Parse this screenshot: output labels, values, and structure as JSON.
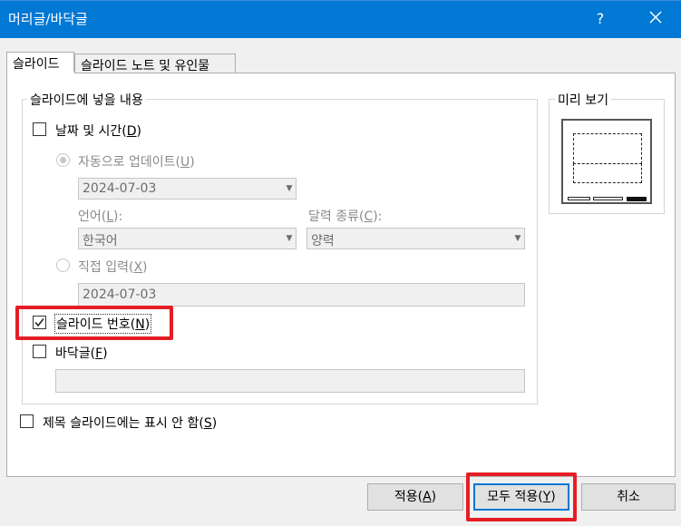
{
  "window": {
    "title": "머리글/바닥글",
    "help_label": "?"
  },
  "tabs": [
    {
      "label": "슬라이드"
    },
    {
      "label": "슬라이드 노트 및 유인물"
    }
  ],
  "include": {
    "legend": "슬라이드에 넣을 내용",
    "date_time": {
      "label": "날짜 및 시간(",
      "key": "D",
      "suffix": ")",
      "checked": false
    },
    "auto_update": {
      "label": "자동으로 업데이트(",
      "key": "U",
      "suffix": ")",
      "selected": true,
      "date_value": "2024-07-03"
    },
    "language": {
      "label": "언어(",
      "key": "L",
      "suffix": "):",
      "value": "한국어"
    },
    "calendar": {
      "label": "달력 종류(",
      "key": "C",
      "suffix": "):",
      "value": "양력"
    },
    "fixed": {
      "label": "직접 입력(",
      "key": "X",
      "suffix": ")",
      "selected": false,
      "value": "2024-07-03"
    },
    "slide_number": {
      "label": "슬라이드 번호(",
      "key": "N",
      "suffix": ")",
      "checked": true
    },
    "footer": {
      "label": "바닥글(",
      "key": "F",
      "suffix": ")",
      "checked": false,
      "value": ""
    }
  },
  "dont_show_title": {
    "label": "제목 슬라이드에는 표시 안 함(",
    "key": "S",
    "suffix": ")",
    "checked": false
  },
  "preview": {
    "legend": "미리 보기"
  },
  "buttons": {
    "apply": {
      "label": "적용(",
      "key": "A",
      "suffix": ")"
    },
    "apply_all": {
      "label": "모두 적용(",
      "key": "Y",
      "suffix": ")"
    },
    "cancel": {
      "label": "취소"
    }
  },
  "colors": {
    "titlebar": "#0078d4",
    "highlight": "#e51e25"
  }
}
